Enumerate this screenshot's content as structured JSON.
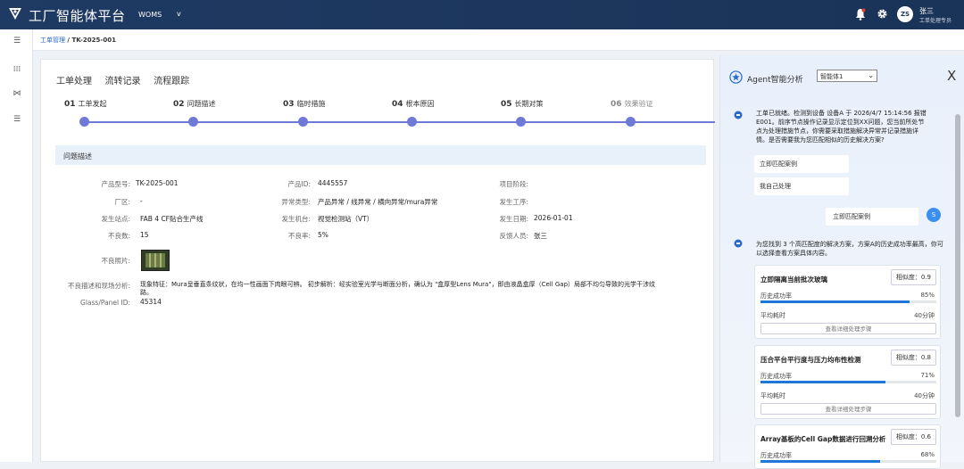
{
  "header": {
    "app_title": "工厂智能体平台",
    "system": "WOMS",
    "system_arrow": "v",
    "avatar": "ZS",
    "user_name": "张三",
    "user_role": "工单处理专员"
  },
  "leftnav": {
    "items": [
      "☰",
      "⁞⁞⁞",
      "⋈",
      "☰"
    ]
  },
  "breadcrumb": {
    "parent": "工单管理",
    "sep": " / ",
    "current": "TK-2025-001"
  },
  "tabs": [
    "工单处理",
    "流转记录",
    "流程跟踪"
  ],
  "steps": [
    {
      "num": "01",
      "label": "工单发起"
    },
    {
      "num": "02",
      "label": "问题描述"
    },
    {
      "num": "03",
      "label": "临时措施"
    },
    {
      "num": "04",
      "label": "根本原因"
    },
    {
      "num": "05",
      "label": "长期对策"
    },
    {
      "num": "06",
      "label": "效果验证"
    }
  ],
  "section_title": "问题描述",
  "fields": {
    "product_model_l": "产品型号:",
    "product_model_v": "TK-2025-001",
    "product_id_l": "产品ID:",
    "product_id_v": "4445557",
    "project_stage_l": "项目阶段:",
    "project_stage_v": "",
    "factory_l": "厂区:",
    "factory_v": "-",
    "abn_type_l": "异常类型:",
    "abn_type_v": "产品异常 / 线异常 / 横向异常/mura异常",
    "process_l": "发生工序:",
    "process_v": "",
    "site_l": "发生站点:",
    "site_v": "FAB 4 CF贴合生产线",
    "machine_l": "发生机台:",
    "machine_v": "视觉检测站（VT）",
    "date_l": "发生日期:",
    "date_v": "2026-01-01",
    "defect_cnt_l": "不良数:",
    "defect_cnt_v": "15",
    "defect_rate_l": "不良率:",
    "defect_rate_v": "5%",
    "reporter_l": "反馈人员:",
    "reporter_v": "张三",
    "photo_l": "不良照片:",
    "desc_l": "不良描述和现场分析:",
    "desc_v": "现象特征：Mura呈垂直条纹状，在均一性画面下肉眼可辨。 初步解析：经实验室光学与断面分析，确认为 \"盒厚型Lens Mura\"，即由液晶盒厚（Cell Gap）局部不均匀导致的光学干涉纹路。",
    "glass_l": "Glass/Panel ID:",
    "glass_v": "45314"
  },
  "agent": {
    "title": "Agent智能分析",
    "selected": "智能体1",
    "close": "X",
    "msg1": "工单已就绪。检测到设备 设备A 于 2026/4/7 15:14:56 报错 E001。前序节点操作记录显示定位到XX问题，您当前所处节点为处理措施节点，你需要采取措施解决异常并记录措施详情。是否需要我为您匹配相似的历史解决方案?",
    "opt1": "立即匹配案例",
    "opt2": "我自己处理",
    "user_msg": "立即匹配案例",
    "user_avatar": "S",
    "msg2": "为您找到 3 个高匹配度的解决方案，方案A的历史成功率最高，你可以选择查看方案具体内容。",
    "sim_prefix": "相似度：",
    "rate_label": "历史成功率",
    "time_label": "平均耗时",
    "detail_label": "查看详细处理步骤",
    "cards": [
      {
        "title": "立即隔离当前批次玻璃",
        "similarity": "0.9",
        "success_rate": "85%",
        "success_value": 0.85,
        "time": "40分钟"
      },
      {
        "title": "压合平台平行度与压力均布性检测",
        "similarity": "0.8",
        "success_rate": "71%",
        "success_value": 0.71,
        "time": "40分钟"
      },
      {
        "title": "Array基板的Cell Gap数据进行回溯分析",
        "similarity": "0.6",
        "success_rate": "68%",
        "success_value": 0.68,
        "time": ""
      }
    ]
  },
  "colors": {
    "topbar": "#1f3a63",
    "accent": "#6f79d8",
    "progress": "#1f77d8",
    "user_bubble": "#3a8ff0"
  }
}
